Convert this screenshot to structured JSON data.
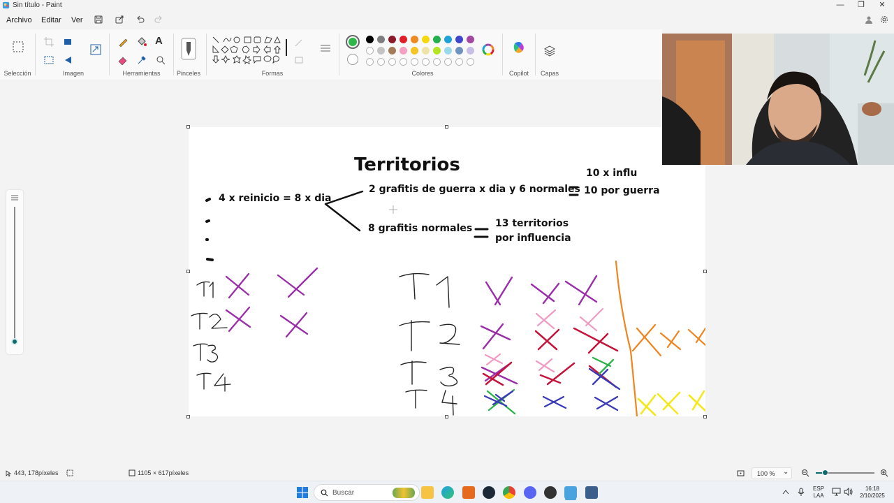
{
  "window": {
    "title": "Sin título - Paint",
    "minimize_glyph": "—",
    "maximize_glyph": "❐",
    "close_glyph": "✕"
  },
  "menu": {
    "items": [
      "Archivo",
      "Editar",
      "Ver"
    ],
    "icons": [
      "save-icon",
      "share-icon",
      "undo-icon",
      "redo-icon"
    ],
    "right_icons": [
      "account-icon",
      "settings-icon"
    ]
  },
  "ribbon": {
    "groups": {
      "seleccion": "Selección",
      "imagen": "Imagen",
      "herramientas": "Herramientas",
      "pinceles": "Pinceles",
      "formas": "Formas",
      "colores": "Colores",
      "copilot": "Copilot",
      "capas": "Capas"
    },
    "text_tool_glyph": "A",
    "selected_color": "#2eb84a",
    "palette_row1": [
      "#000000",
      "#7f7f7f",
      "#8b1a2b",
      "#e11d2a",
      "#f08a24",
      "#f5d90a",
      "#22b14c",
      "#1fa3d6",
      "#3f48cc",
      "#a349a4"
    ],
    "palette_row2": [
      "#ffffff",
      "#c3c3c3",
      "#a57a5a",
      "#f5a0c0",
      "#f5c423",
      "#ede4a6",
      "#b5e61d",
      "#99d9ea",
      "#7092be",
      "#c8bfe7"
    ],
    "palette_row3_empty": 10
  },
  "canvas": {
    "title": "Territorios",
    "line1_left": "4 x reinicio = 8 x dia",
    "line1_right": "2 grafitis de guerra x dia y 6 normales",
    "line2_left": "8 grafitis normales",
    "result_top_1": "10 x influ",
    "result_top_2": "10 por guerra",
    "result_bottom_1": "13 territorios",
    "result_bottom_2": "por influencia",
    "equals": "=",
    "rows_left": [
      "T1",
      "T2",
      "T3",
      "T4"
    ],
    "rows_right": [
      "T1",
      "T2",
      "T3",
      "T4"
    ]
  },
  "status": {
    "cursor_position": "443, 178píxeles",
    "canvas_size": "1105 × 617píxeles",
    "zoom": "100 %",
    "zoom_dropdown": "⌄"
  },
  "taskbar": {
    "search_placeholder": "Buscar",
    "lang_1": "ESP",
    "lang_2": "LAA",
    "time": "16:18",
    "date": "2/10/2025"
  }
}
